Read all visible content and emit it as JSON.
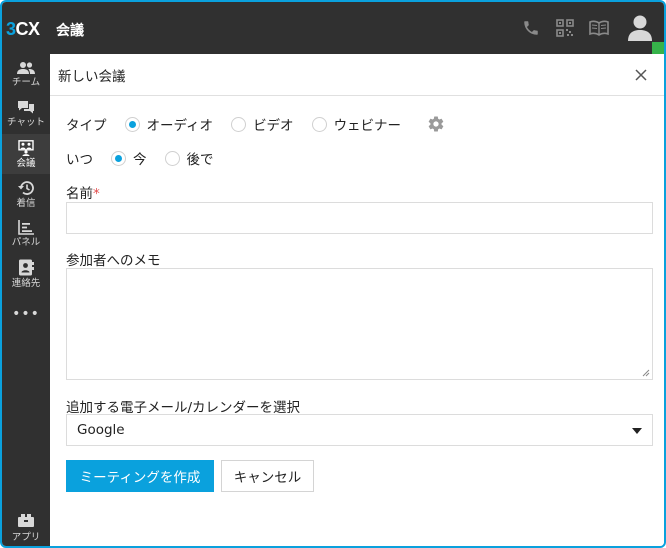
{
  "app": {
    "logo_three": "3",
    "logo_cx": "CX",
    "title": "会議"
  },
  "topbar": {
    "icons": [
      "phone-icon",
      "qr-code-icon",
      "book-icon",
      "user-avatar-icon"
    ],
    "presence_color": "#36b34a"
  },
  "sidebar": {
    "items": [
      {
        "label": "チーム",
        "icon": "team-icon"
      },
      {
        "label": "チャット",
        "icon": "chat-icon"
      },
      {
        "label": "会議",
        "icon": "conference-icon",
        "active": true
      },
      {
        "label": "着信",
        "icon": "history-icon"
      },
      {
        "label": "パネル",
        "icon": "panel-icon"
      },
      {
        "label": "連絡先",
        "icon": "contacts-icon"
      }
    ],
    "more": "•••",
    "apps_label": "アプリ"
  },
  "dialog": {
    "title": "新しい会議",
    "type_label": "タイプ",
    "type_options": [
      "オーディオ",
      "ビデオ",
      "ウェビナー"
    ],
    "type_selected": "オーディオ",
    "when_label": "いつ",
    "when_options": [
      "今",
      "後で"
    ],
    "when_selected": "今",
    "name_label": "名前",
    "name_required": "*",
    "name_value": "",
    "memo_label": "参加者へのメモ",
    "memo_value": "",
    "calendar_label": "追加する電子メール/カレンダーを選択",
    "calendar_selected": "Google",
    "create_button": "ミーティングを作成",
    "cancel_button": "キャンセル"
  },
  "colors": {
    "accent": "#0aa1dd",
    "dark": "#303030",
    "required": "#e24b4b"
  }
}
